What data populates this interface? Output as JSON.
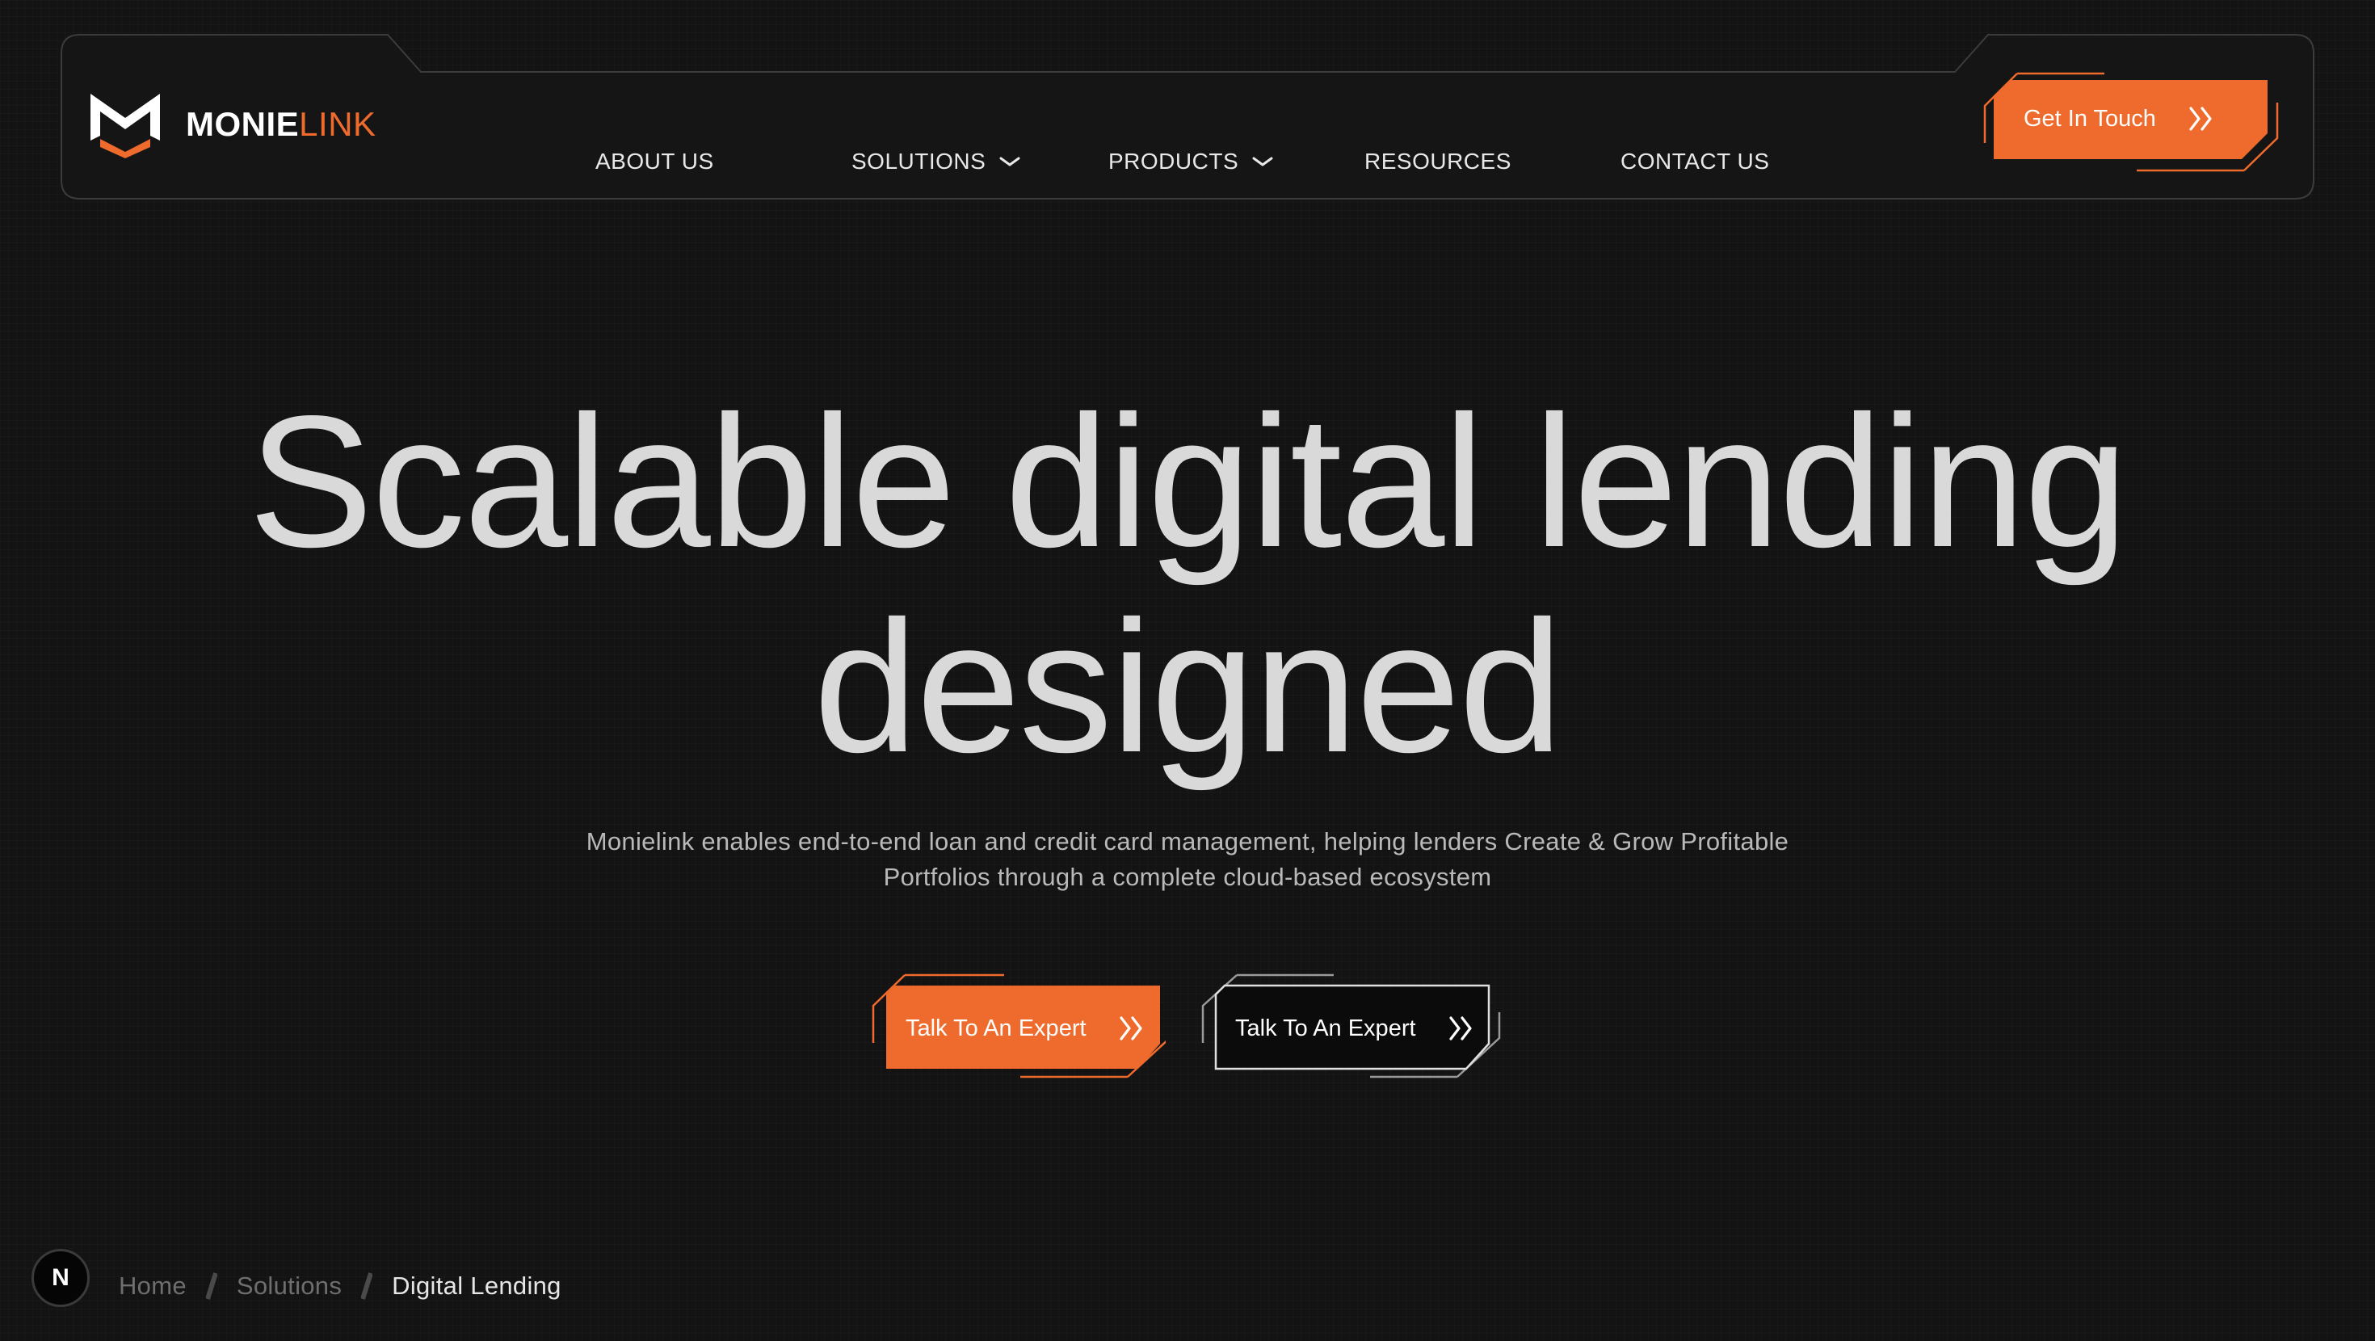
{
  "brand": {
    "name_part1": "MONIE",
    "name_part2": "LINK",
    "accent_color": "#ee6b2d",
    "logo_icon": "monielink-m-logo-icon"
  },
  "nav": {
    "items": [
      {
        "label": "ABOUT US",
        "has_dropdown": false
      },
      {
        "label": "SOLUTIONS",
        "has_dropdown": true
      },
      {
        "label": "PRODUCTS",
        "has_dropdown": true
      },
      {
        "label": "RESOURCES",
        "has_dropdown": false
      },
      {
        "label": "CONTACT US",
        "has_dropdown": false
      }
    ],
    "cta_label": "Get In Touch",
    "cta_icon": "double-chevron-right-icon"
  },
  "hero": {
    "title_line1": "Scalable digital lending",
    "title_line2": "designed",
    "subtitle_line1": "Monielink enables end-to-end loan and credit card management, helping lenders Create & Grow Profitable",
    "subtitle_line2": "Portfolios through a complete cloud-based ecosystem",
    "primary_button": "Talk To An Expert",
    "secondary_button": "Talk To An Expert"
  },
  "breadcrumb": {
    "badge": "N",
    "items": [
      "Home",
      "Solutions",
      "Digital Lending"
    ]
  },
  "colors": {
    "background": "#131313",
    "accent": "#ee6b2d",
    "text_primary": "#d9d9d9",
    "text_muted": "#6e6e6e"
  }
}
